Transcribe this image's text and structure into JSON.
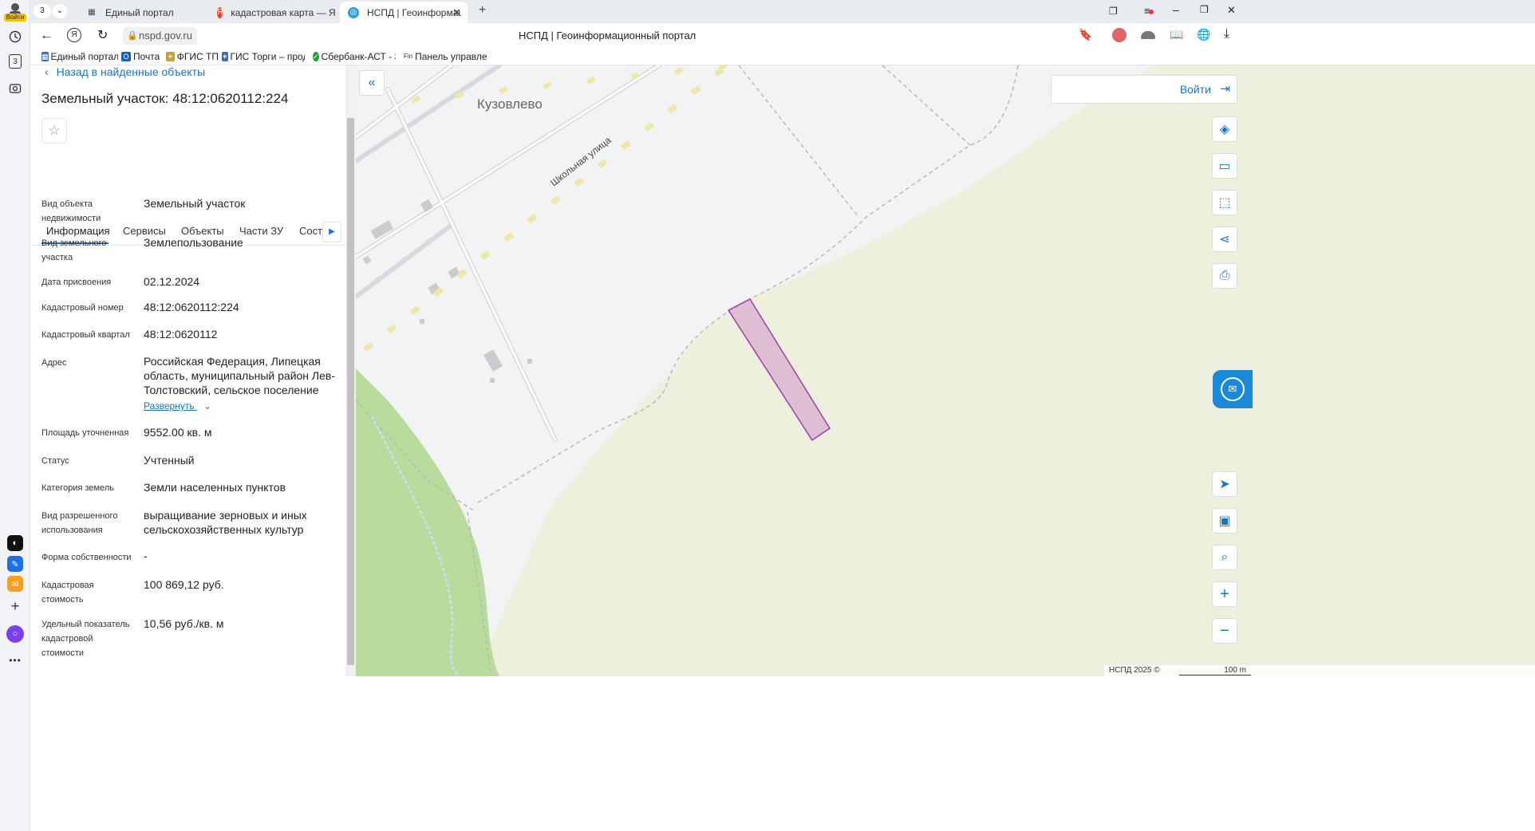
{
  "browser": {
    "tab_count": "3",
    "profile_label": "Войти",
    "tabs": [
      {
        "label": "Единый портал"
      },
      {
        "label": "кадастровая карта — Янд"
      },
      {
        "label": "НСПД | Геоинформаци"
      }
    ],
    "url": "nspd.gov.ru",
    "page_title": "НСПД | Геоинформационный портал",
    "bookmarks": [
      {
        "label": "Единый портал"
      },
      {
        "label": "Почта"
      },
      {
        "label": "ФГИС ТП"
      },
      {
        "label": "ГИС Торги – прод"
      },
      {
        "label": "Сбербанк-АСТ - З"
      },
      {
        "label": "Панель управлен"
      }
    ],
    "rail_badge": "3"
  },
  "panel": {
    "back_link": "Назад в найденные объекты",
    "title": "Земельный участок: 48:12:0620112:224",
    "tabs": [
      "Информация",
      "Сервисы",
      "Объекты",
      "Части ЗУ",
      "Соста"
    ],
    "active_tab": "Информация",
    "expand_link": "Развернуть",
    "fields": [
      {
        "label": "Вид объекта недвижимости",
        "value": "Земельный участок"
      },
      {
        "label": "Вид земельного участка",
        "value": "Землепользование"
      },
      {
        "label": "Дата присвоения",
        "value": "02.12.2024"
      },
      {
        "label": "Кадастровый номер",
        "value": "48:12:0620112:224"
      },
      {
        "label": "Кадастровый квартал",
        "value": "48:12:0620112"
      },
      {
        "label": "Адрес",
        "value": "Российская Федерация, Липецкая область, муниципальный район Лев-Толстовский, сельское поселение"
      },
      {
        "label": "Площадь уточненная",
        "value": "9552.00 кв. м"
      },
      {
        "label": "Статус",
        "value": "Учтенный"
      },
      {
        "label": "Категория земель",
        "value": "Земли населенных пунктов"
      },
      {
        "label": "Вид разрешенного использования",
        "value": "выращивание зерновых и иных сельскохозяйственных культур"
      },
      {
        "label": "Форма собственности",
        "value": "-"
      },
      {
        "label": "Кадастровая стоимость",
        "value": "100 869,12 руб."
      },
      {
        "label": "Удельный показатель кадастровой стоимости",
        "value": "10,56 руб./кв. м"
      }
    ]
  },
  "map": {
    "login_label": "Войти",
    "village_label": "Кузовлево",
    "street_label": "Школьная улица",
    "copyright": "НСПД 2025 ©",
    "scale_label": "100 m",
    "parcel_color": "#a23bb0",
    "field_color": "#eef0de",
    "forest_color": "#b8dc9c"
  },
  "icons": {
    "map_controls_top": [
      "layers-icon",
      "ruler-icon",
      "area-select-icon",
      "share-icon",
      "print-icon"
    ],
    "map_controls_bottom": [
      "locate-icon",
      "minimap-icon",
      "search-location-icon",
      "zoom-in-icon",
      "zoom-out-icon"
    ]
  }
}
